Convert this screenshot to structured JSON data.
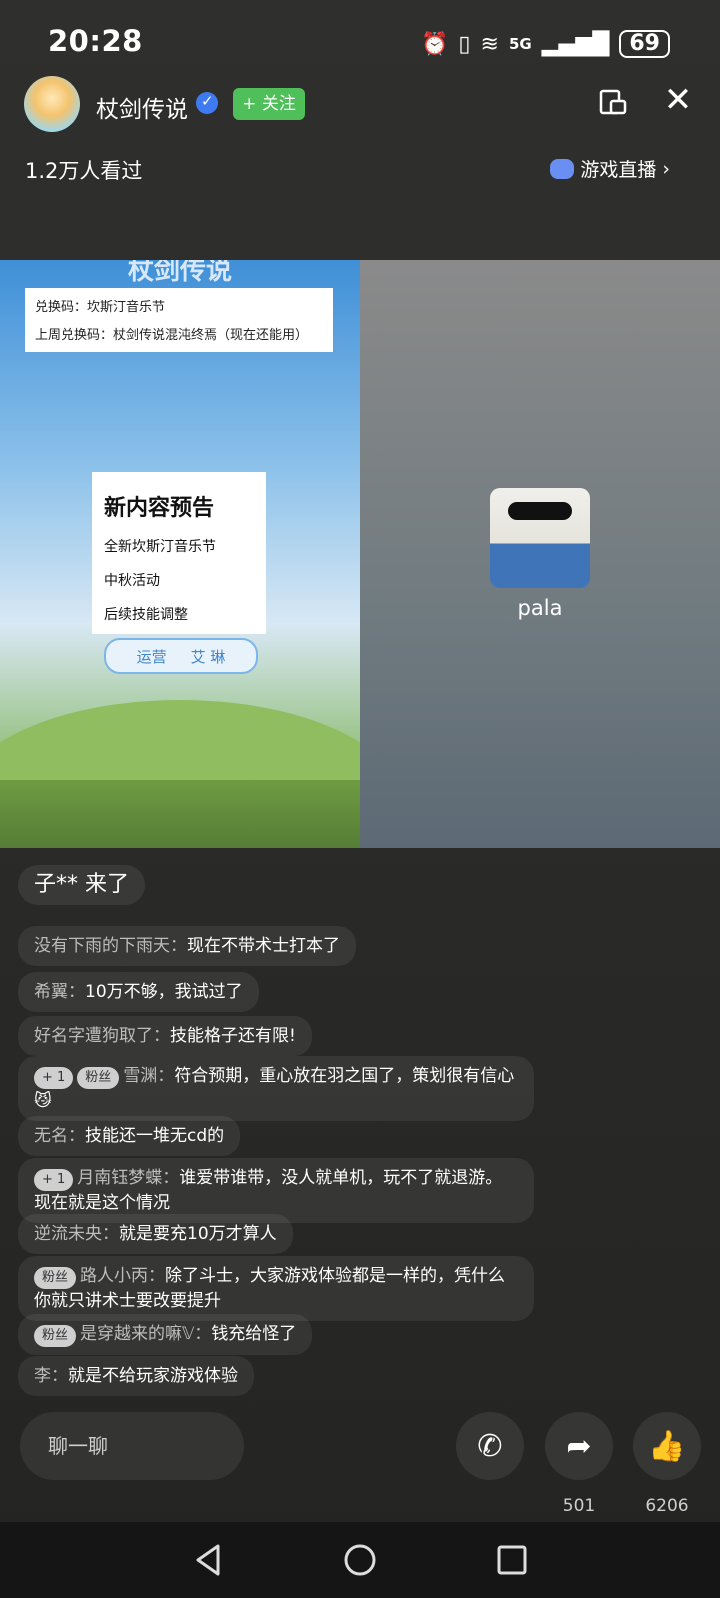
{
  "status_bar": {
    "time": "20:28",
    "network_label": "5G",
    "battery": "69"
  },
  "header": {
    "streamer_name": "杖剑传说",
    "follow_label": "+ 关注"
  },
  "info_row": {
    "viewers": "1.2万人看过",
    "category": "游戏直播"
  },
  "stream": {
    "game_title": "杖剑传说",
    "code_line1": "兑换码：坎斯汀音乐节",
    "code_line2": "上周兑换码：杖剑传说混沌终焉（现在还能用）",
    "preview_title": "新内容预告",
    "preview_items": [
      "全新坎斯汀音乐节",
      "中秋活动",
      "后续技能调整"
    ],
    "ops_tag_left": "运营",
    "ops_tag_right": "艾 琳",
    "guest_name": "pala"
  },
  "chat": {
    "enter_notice": "子** 来了",
    "messages": [
      {
        "user": "没有下雨的下雨天：",
        "text": "现在不带术士打本了"
      },
      {
        "user": "希翼：",
        "text": "10万不够，我试过了"
      },
      {
        "user": "好名字遭狗取了：",
        "text": "技能格子还有限!"
      },
      {
        "badge1": "+ 1",
        "badge2": "粉丝",
        "user": "雪渊：",
        "text": "符合预期，重心放在羽之国了，策划很有信心😼"
      },
      {
        "user": "无名：",
        "text": "技能还一堆无cd的"
      },
      {
        "badge1": "+ 1",
        "user": "月南钰梦蝶：",
        "text": "谁爱带谁带，没人就单机，玩不了就退游。现在就是这个情况"
      },
      {
        "user": "逆流未央：",
        "text": "就是要充10万才算人"
      },
      {
        "badge2": "粉丝",
        "user": "路人小丙：",
        "text": "除了斗士，大家游戏体验都是一样的，凭什么你就只讲术士要改要提升"
      },
      {
        "badge2": "粉丝",
        "user": "是穿越来的嘛𝕍：",
        "text": "钱充给怪了"
      },
      {
        "user": "李：",
        "text": "就是不给玩家游戏体验"
      }
    ]
  },
  "bottom": {
    "chat_placeholder": "聊一聊",
    "share_count": "501",
    "like_count": "6206"
  }
}
